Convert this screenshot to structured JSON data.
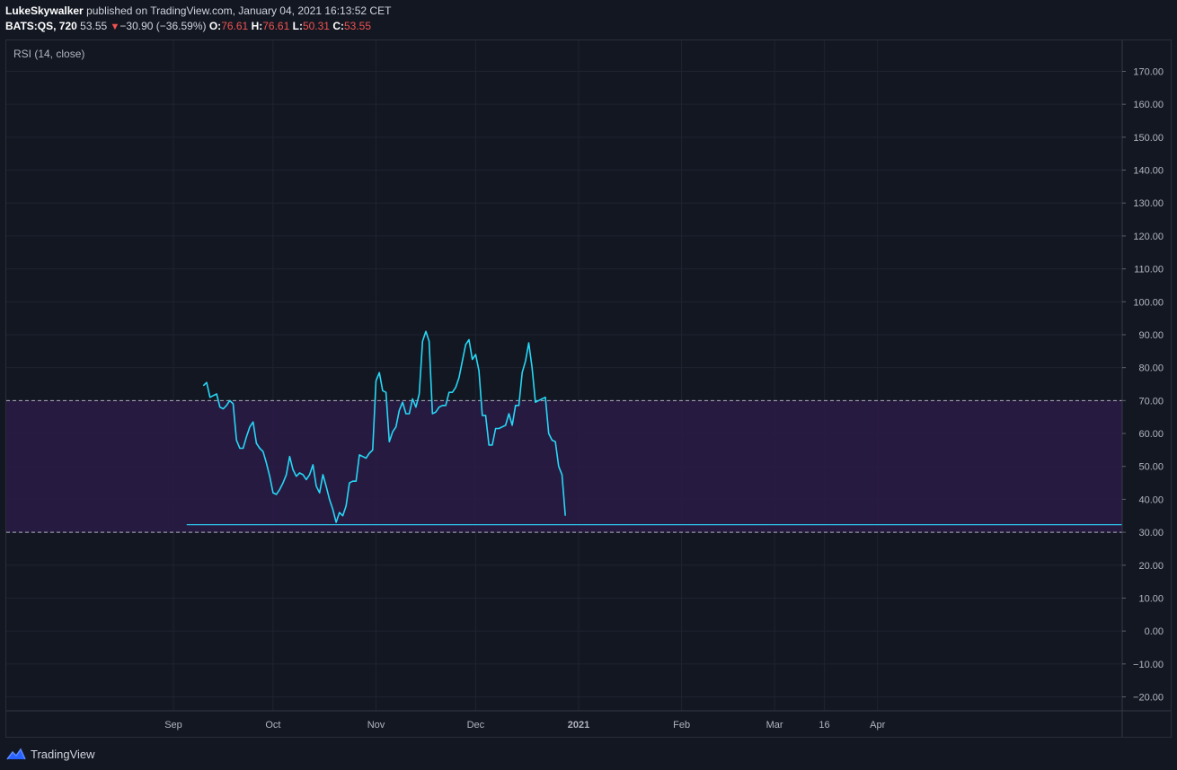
{
  "header": {
    "author": "LukeSkywalker",
    "published": "published on TradingView.com, January 04, 2021 16:13:52 CET",
    "symbol": "BATS:QS, 720",
    "last": "53.55",
    "change": "−30.90 (−36.59%)",
    "o_label": "O:",
    "o_value": "76.61",
    "h_label": "H:",
    "h_value": "76.61",
    "l_label": "L:",
    "l_value": "50.31",
    "c_label": "C:",
    "c_value": "53.55"
  },
  "indicator_label": "RSI (14, close)",
  "footer": {
    "brand": "TradingView"
  },
  "colors": {
    "background": "#131722",
    "grid": "#1f2330",
    "band_fill": "#2a1b45",
    "rsi_line": "#26d7f5",
    "level_line": "#d1d4dc",
    "support_line": "#2ac4e8",
    "down_red": "#ef5350"
  },
  "chart_data": {
    "type": "line",
    "title": "RSI (14, close)",
    "xlabel": "",
    "ylabel": "",
    "ylim": [
      -25,
      178
    ],
    "y_ticks": [
      "170.00",
      "160.00",
      "150.00",
      "140.00",
      "130.00",
      "120.00",
      "110.00",
      "100.00",
      "90.00",
      "80.00",
      "70.00",
      "60.00",
      "50.00",
      "40.00",
      "30.00",
      "20.00",
      "10.00",
      "0.00",
      "−10.00",
      "−20.00"
    ],
    "y_tick_values": [
      170,
      160,
      150,
      140,
      130,
      120,
      110,
      100,
      90,
      80,
      70,
      60,
      50,
      40,
      30,
      20,
      10,
      0,
      -10,
      -20
    ],
    "x_ticks": [
      {
        "label": "Sep",
        "date": "2020-09-01",
        "bold": false
      },
      {
        "label": "Oct",
        "date": "2020-10-01",
        "bold": false
      },
      {
        "label": "Nov",
        "date": "2020-11-01",
        "bold": false
      },
      {
        "label": "Dec",
        "date": "2020-12-01",
        "bold": false
      },
      {
        "label": "2021",
        "date": "2021-01-01",
        "bold": true
      },
      {
        "label": "Feb",
        "date": "2021-02-01",
        "bold": false
      },
      {
        "label": "Mar",
        "date": "2021-03-01",
        "bold": false
      },
      {
        "label": "16",
        "date": "2021-03-16",
        "bold": false
      },
      {
        "label": "Apr",
        "date": "2021-04-01",
        "bold": false
      }
    ],
    "x_range": [
      "2020-08-01",
      "2021-04-30"
    ],
    "upper_band": 70,
    "lower_band": 30,
    "support_level": 32.3,
    "support_start": "2020-09-05",
    "series": [
      {
        "values": [
          [
            "2020-09-10",
            74.5
          ],
          [
            "2020-09-11",
            75.5
          ],
          [
            "2020-09-12",
            71
          ],
          [
            "2020-09-13",
            71.5
          ],
          [
            "2020-09-14",
            72
          ],
          [
            "2020-09-15",
            68
          ],
          [
            "2020-09-16",
            67.5
          ],
          [
            "2020-09-17",
            68.5
          ],
          [
            "2020-09-18",
            70
          ],
          [
            "2020-09-19",
            69
          ],
          [
            "2020-09-20",
            58
          ],
          [
            "2020-09-21",
            55.5
          ],
          [
            "2020-09-22",
            55.5
          ],
          [
            "2020-09-23",
            59
          ],
          [
            "2020-09-24",
            62
          ],
          [
            "2020-09-25",
            63.5
          ],
          [
            "2020-09-26",
            57
          ],
          [
            "2020-09-27",
            55.5
          ],
          [
            "2020-09-28",
            54.5
          ],
          [
            "2020-09-29",
            51
          ],
          [
            "2020-09-30",
            47
          ],
          [
            "2020-10-01",
            42
          ],
          [
            "2020-10-02",
            41.5
          ],
          [
            "2020-10-03",
            43
          ],
          [
            "2020-10-04",
            45
          ],
          [
            "2020-10-05",
            47.5
          ],
          [
            "2020-10-06",
            53
          ],
          [
            "2020-10-07",
            49
          ],
          [
            "2020-10-08",
            47
          ],
          [
            "2020-10-09",
            48
          ],
          [
            "2020-10-10",
            47.5
          ],
          [
            "2020-10-11",
            46
          ],
          [
            "2020-10-12",
            47.5
          ],
          [
            "2020-10-13",
            50.5
          ],
          [
            "2020-10-14",
            44
          ],
          [
            "2020-10-15",
            42
          ],
          [
            "2020-10-16",
            47.5
          ],
          [
            "2020-10-17",
            44
          ],
          [
            "2020-10-18",
            40
          ],
          [
            "2020-10-19",
            37
          ],
          [
            "2020-10-20",
            33
          ],
          [
            "2020-10-21",
            36
          ],
          [
            "2020-10-22",
            35
          ],
          [
            "2020-10-23",
            38
          ],
          [
            "2020-10-24",
            45
          ],
          [
            "2020-10-25",
            45.5
          ],
          [
            "2020-10-26",
            45.5
          ],
          [
            "2020-10-27",
            53.5
          ],
          [
            "2020-10-28",
            53
          ],
          [
            "2020-10-29",
            52.5
          ],
          [
            "2020-10-30",
            54
          ],
          [
            "2020-10-31",
            55
          ],
          [
            "2020-11-01",
            76
          ],
          [
            "2020-11-02",
            78.5
          ],
          [
            "2020-11-03",
            73
          ],
          [
            "2020-11-04",
            72.5
          ],
          [
            "2020-11-05",
            57.5
          ],
          [
            "2020-11-06",
            60.5
          ],
          [
            "2020-11-07",
            62
          ],
          [
            "2020-11-08",
            67
          ],
          [
            "2020-11-09",
            69.5
          ],
          [
            "2020-11-10",
            66
          ],
          [
            "2020-11-11",
            66
          ],
          [
            "2020-11-12",
            70.5
          ],
          [
            "2020-11-13",
            68
          ],
          [
            "2020-11-14",
            72
          ],
          [
            "2020-11-15",
            88
          ],
          [
            "2020-11-16",
            91
          ],
          [
            "2020-11-17",
            88
          ],
          [
            "2020-11-18",
            66
          ],
          [
            "2020-11-19",
            66.5
          ],
          [
            "2020-11-20",
            68
          ],
          [
            "2020-11-21",
            68.5
          ],
          [
            "2020-11-22",
            68.5
          ],
          [
            "2020-11-23",
            72.5
          ],
          [
            "2020-11-24",
            72.5
          ],
          [
            "2020-11-25",
            74
          ],
          [
            "2020-11-26",
            77
          ],
          [
            "2020-11-27",
            82
          ],
          [
            "2020-11-28",
            87
          ],
          [
            "2020-11-29",
            88.5
          ],
          [
            "2020-11-30",
            82.5
          ],
          [
            "2020-12-01",
            84
          ],
          [
            "2020-12-02",
            79
          ],
          [
            "2020-12-03",
            65.5
          ],
          [
            "2020-12-04",
            65.5
          ],
          [
            "2020-12-05",
            56.5
          ],
          [
            "2020-12-06",
            56.5
          ],
          [
            "2020-12-07",
            61.5
          ],
          [
            "2020-12-08",
            61.5
          ],
          [
            "2020-12-09",
            62
          ],
          [
            "2020-12-10",
            62.5
          ],
          [
            "2020-12-11",
            66
          ],
          [
            "2020-12-12",
            62.5
          ],
          [
            "2020-12-13",
            68.5
          ],
          [
            "2020-12-14",
            68.5
          ],
          [
            "2020-12-15",
            78.5
          ],
          [
            "2020-12-16",
            82
          ],
          [
            "2020-12-17",
            87.5
          ],
          [
            "2020-12-18",
            80
          ],
          [
            "2020-12-19",
            69.5
          ],
          [
            "2020-12-20",
            70
          ],
          [
            "2020-12-21",
            70.5
          ],
          [
            "2020-12-22",
            71
          ],
          [
            "2020-12-23",
            60
          ],
          [
            "2020-12-24",
            58
          ],
          [
            "2020-12-25",
            57.5
          ],
          [
            "2020-12-26",
            50
          ],
          [
            "2020-12-27",
            47.5
          ],
          [
            "2020-12-28",
            35
          ]
        ]
      }
    ],
    "grid": true,
    "legend": "none"
  }
}
